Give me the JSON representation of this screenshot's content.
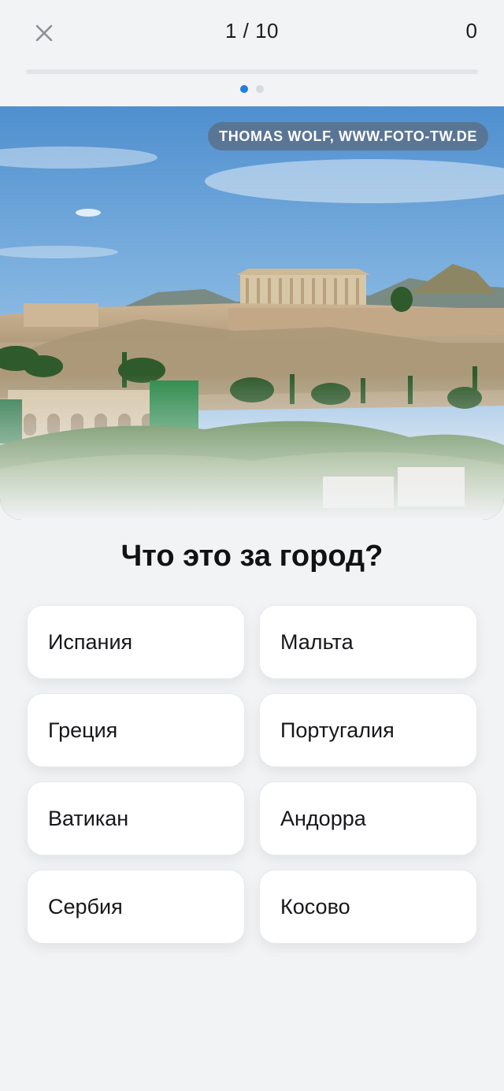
{
  "header": {
    "close_icon": "close-icon",
    "counter": "1 / 10",
    "score": "0",
    "progress": 0.1,
    "page_dots": {
      "total": 2,
      "active": 1
    }
  },
  "photo": {
    "credit": "THOMAS WOLF, WWW.FOTO-TW.DE"
  },
  "question": "Что это за город?",
  "answers": [
    {
      "label": "Испания"
    },
    {
      "label": "Мальта"
    },
    {
      "label": "Греция"
    },
    {
      "label": "Португалия"
    },
    {
      "label": "Ватикан"
    },
    {
      "label": "Андорра"
    },
    {
      "label": "Сербия"
    },
    {
      "label": "Косово"
    }
  ],
  "colors": {
    "accent": "#1f7ee0",
    "background": "#f2f3f5",
    "card": "#ffffff"
  }
}
